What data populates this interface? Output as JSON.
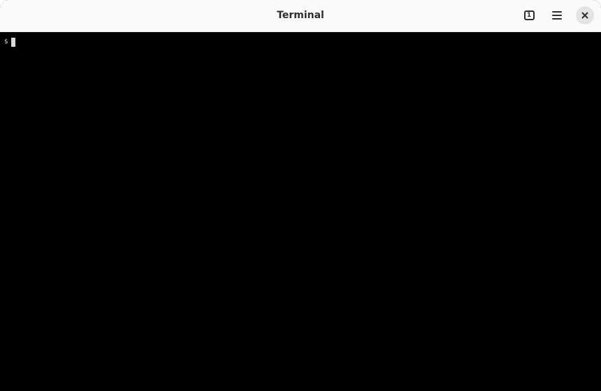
{
  "window": {
    "title": "Terminal"
  },
  "header": {
    "tabs_count": "1",
    "tabs_icon": "tab-overview-icon",
    "menu_icon": "hamburger-menu-icon",
    "close_icon": "close-icon"
  },
  "terminal": {
    "prompt": "$",
    "input": "",
    "background": "#000000",
    "foreground": "#d0d0d0"
  }
}
